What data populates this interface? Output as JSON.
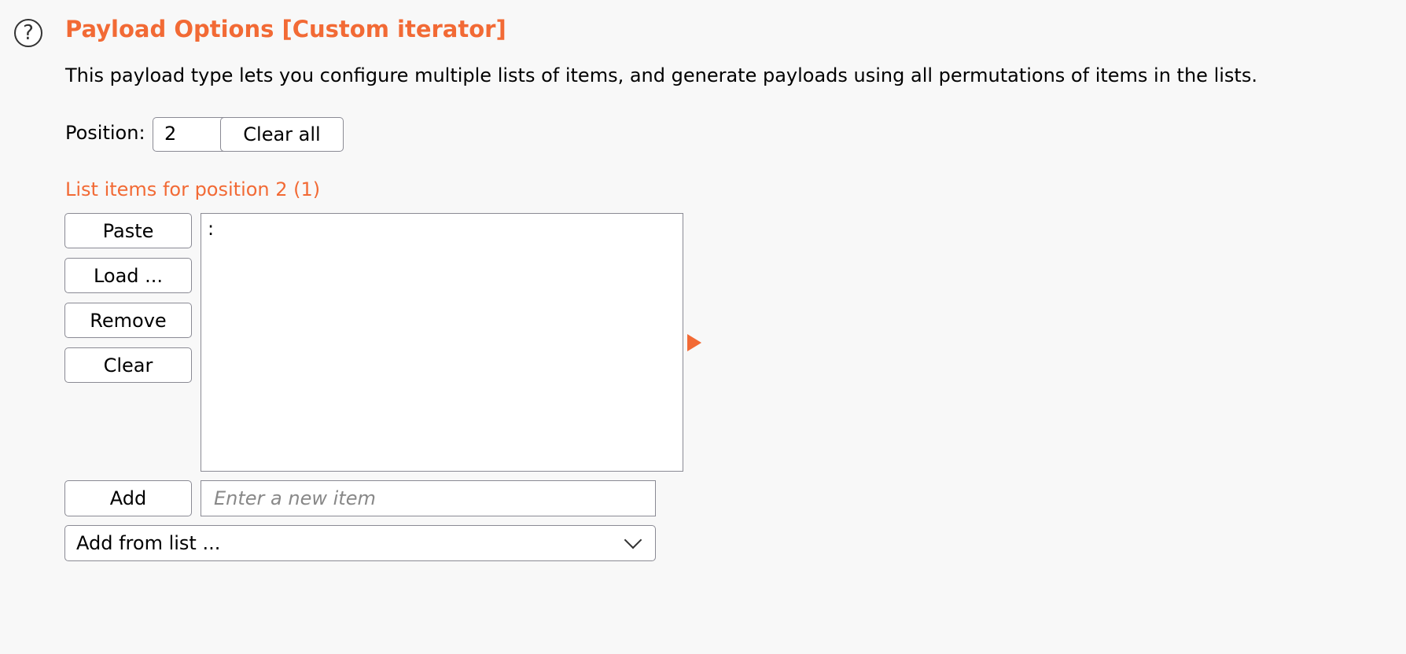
{
  "header": {
    "help_symbol": "?",
    "title": "Payload Options [Custom iterator]",
    "description": "This payload type lets you configure multiple lists of items, and generate payloads using all permutations of items in the lists."
  },
  "position": {
    "label": "Position:",
    "value": "2",
    "clear_all_label": "Clear all"
  },
  "list": {
    "title": "List items for position 2 (1)",
    "buttons": {
      "paste": "Paste",
      "load": "Load ...",
      "remove": "Remove",
      "clear": "Clear"
    },
    "items": [
      ":"
    ]
  },
  "add": {
    "button_label": "Add",
    "placeholder": "Enter a new item",
    "from_list_label": "Add from list ..."
  },
  "colors": {
    "accent": "#f26a35",
    "background": "#f8f8f8",
    "border": "#8a8a94"
  },
  "icons": {
    "help": "help-circle-icon",
    "arrow": "triangle-right-icon",
    "dropdown": "chevron-down-icon"
  }
}
